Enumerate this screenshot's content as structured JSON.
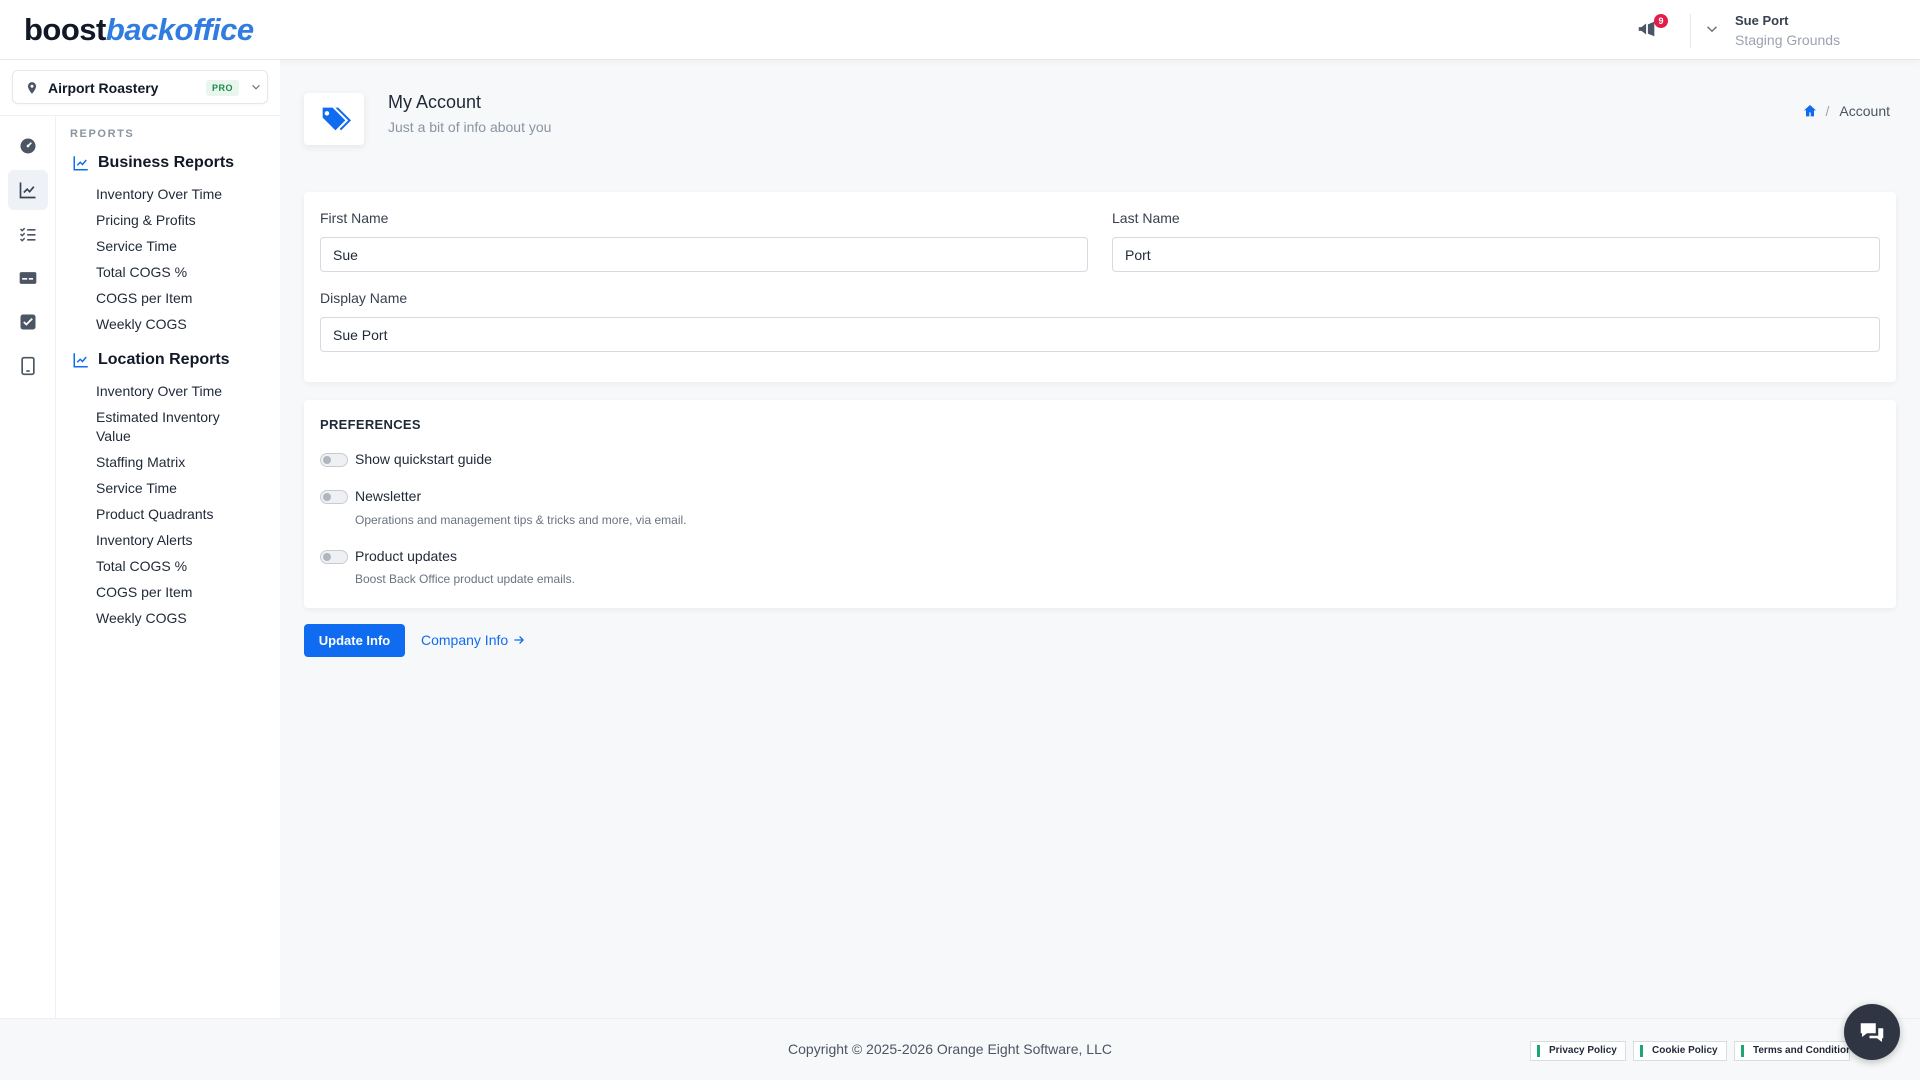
{
  "brand": {
    "part1": "boost",
    "part2": "backoffice"
  },
  "header": {
    "notification_count": "9",
    "user_name": "Sue Port",
    "user_org": "Staging Grounds"
  },
  "location": {
    "name": "Airport Roastery",
    "tier": "PRO"
  },
  "menu": {
    "caption": "REPORTS",
    "groups": [
      {
        "label": "Business Reports",
        "items": [
          "Inventory Over Time",
          "Pricing & Profits",
          "Service Time",
          "Total COGS %",
          "COGS per Item",
          "Weekly COGS"
        ]
      },
      {
        "label": "Location Reports",
        "items": [
          "Inventory Over Time",
          "Estimated Inventory Value",
          "Staffing Matrix",
          "Service Time",
          "Product Quadrants",
          "Inventory Alerts",
          "Total COGS %",
          "COGS per Item",
          "Weekly COGS"
        ]
      }
    ]
  },
  "page": {
    "title": "My Account",
    "subtitle": "Just a bit of info about you"
  },
  "breadcrumb": {
    "current": "Account"
  },
  "form": {
    "first_name_label": "First Name",
    "first_name_value": "Sue",
    "last_name_label": "Last Name",
    "last_name_value": "Port",
    "display_name_label": "Display Name",
    "display_name_value": "Sue Port"
  },
  "preferences": {
    "title": "PREFERENCES",
    "items": [
      {
        "label": "Show quickstart guide",
        "description": "",
        "enabled": false
      },
      {
        "label": "Newsletter",
        "description": "Operations and management tips & tricks and more, via email.",
        "enabled": false
      },
      {
        "label": "Product updates",
        "description": "Boost Back Office product update emails.",
        "enabled": false
      }
    ]
  },
  "actions": {
    "update_label": "Update Info",
    "company_link": "Company Info"
  },
  "footer": {
    "copyright": "Copyright © 2025-2026 Orange Eight Software, LLC",
    "privacy": "Privacy Policy",
    "cookie": "Cookie Policy",
    "terms": "Terms and Conditions"
  },
  "colors": {
    "accent": "#0f6cf1",
    "brand_blue": "#2f7de1",
    "pro_badge": "#1f8a4c"
  }
}
